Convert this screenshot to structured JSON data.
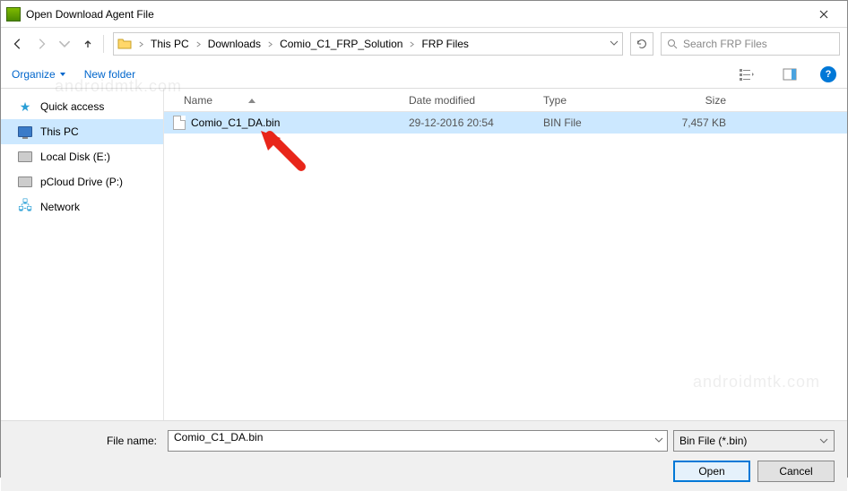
{
  "window": {
    "title": "Open Download Agent File"
  },
  "breadcrumb": {
    "items": [
      "This PC",
      "Downloads",
      "Comio_C1_FRP_Solution",
      "FRP Files"
    ]
  },
  "search": {
    "placeholder": "Search FRP Files"
  },
  "toolbar": {
    "organize": "Organize",
    "new_folder": "New folder"
  },
  "sidebar": {
    "items": [
      {
        "label": "Quick access"
      },
      {
        "label": "This PC"
      },
      {
        "label": "Local Disk (E:)"
      },
      {
        "label": "pCloud Drive (P:)"
      },
      {
        "label": "Network"
      }
    ]
  },
  "columns": {
    "name": "Name",
    "date": "Date modified",
    "type": "Type",
    "size": "Size"
  },
  "files": [
    {
      "name": "Comio_C1_DA.bin",
      "date": "29-12-2016 20:54",
      "type": "BIN File",
      "size": "7,457 KB"
    }
  ],
  "footer": {
    "filename_label": "File name:",
    "filename_value": "Comio_C1_DA.bin",
    "filter": "Bin File (*.bin)",
    "open": "Open",
    "cancel": "Cancel"
  },
  "watermark": "androidmtk.com"
}
